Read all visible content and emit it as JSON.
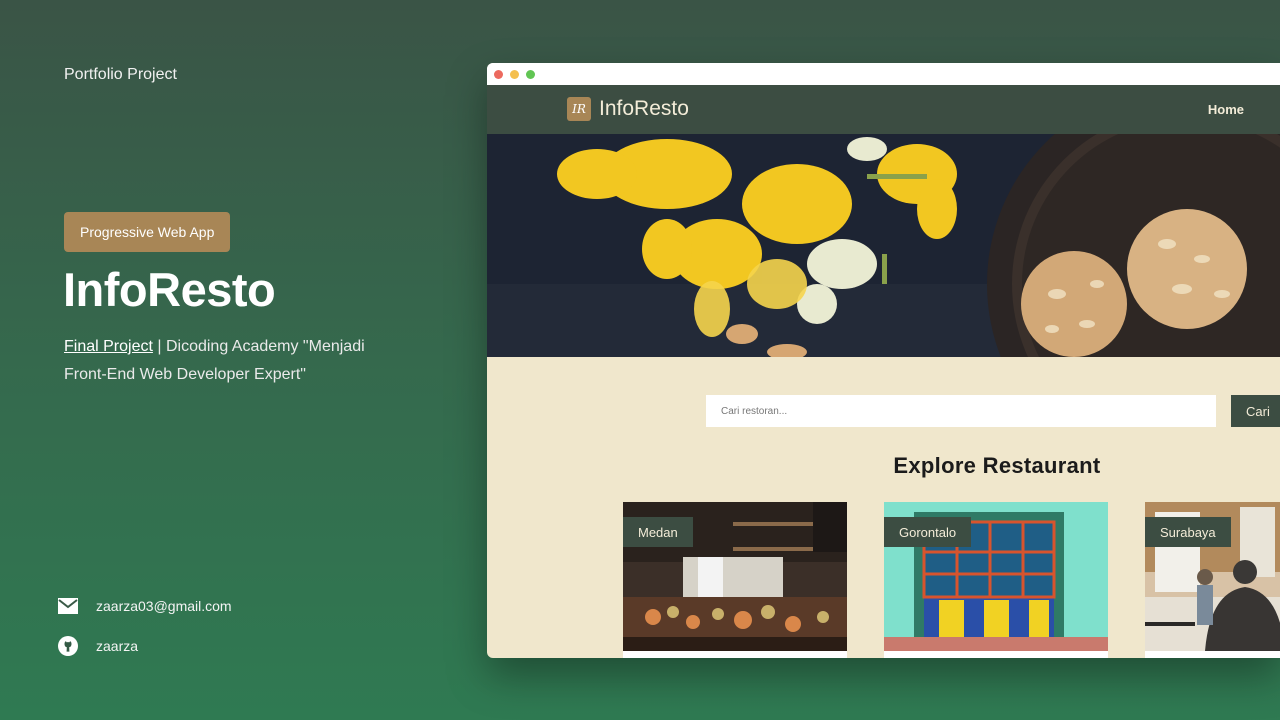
{
  "left": {
    "eyebrow": "Portfolio Project",
    "badge": "Progressive Web App",
    "title": "InfoResto",
    "desc_link": "Final Project",
    "desc_rest": " | Dicoding Academy \"Menjadi Front-End Web Developer Expert\"",
    "email": "zaarza03@gmail.com",
    "github": "zaarza"
  },
  "browser": {
    "dots": [
      "#ec6a5f",
      "#f4bf4f",
      "#61c554"
    ],
    "logo_mark": "IR",
    "logo": "InfoResto",
    "nav_home": "Home",
    "search_placeholder": "Cari restoran...",
    "search_button": "Cari",
    "heading": "Explore Restaurant",
    "cards": [
      {
        "city": "Medan"
      },
      {
        "city": "Gorontalo"
      },
      {
        "city": "Surabaya"
      }
    ]
  },
  "colors": {
    "accent": "#a88656",
    "nav_dark": "#3c4d42",
    "cream": "#f0e7cc"
  },
  "icons": [
    "mail-icon",
    "github-icon"
  ]
}
